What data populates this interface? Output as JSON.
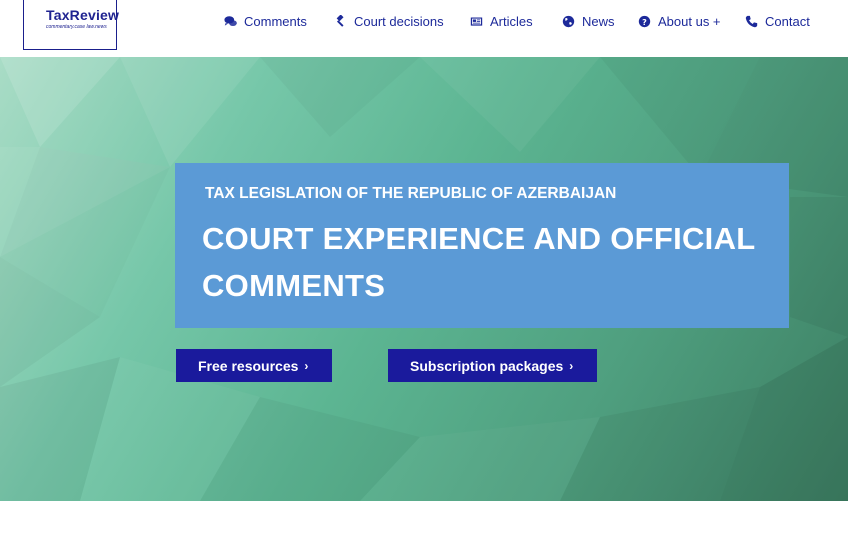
{
  "logo": {
    "title": "TaxReview",
    "subtitle": "commentary.case law.news"
  },
  "nav": {
    "items": [
      {
        "label": "Comments",
        "icon": "comments-icon"
      },
      {
        "label": "Court decisions",
        "icon": "gavel-icon"
      },
      {
        "label": "Articles",
        "icon": "newspaper-icon"
      },
      {
        "label": "News",
        "icon": "globe-icon"
      },
      {
        "label": "About us +",
        "icon": "question-circle-icon"
      },
      {
        "label": "Contact",
        "icon": "phone-icon"
      }
    ]
  },
  "hero": {
    "subtitle": "TAX LEGISLATION OF THE REPUBLIC OF AZERBAIJAN",
    "title": "COURT EXPERIENCE AND OFFICIAL COMMENTS",
    "buttons": {
      "free": "Free resources",
      "subscription": "Subscription packages",
      "chevron": "›"
    }
  },
  "colors": {
    "brand": "#1a1a9c",
    "nav_text": "#1d2a9a",
    "banner": "#5b9ad6",
    "hero_start": "#a9dcc6",
    "hero_end": "#3c7e62"
  }
}
